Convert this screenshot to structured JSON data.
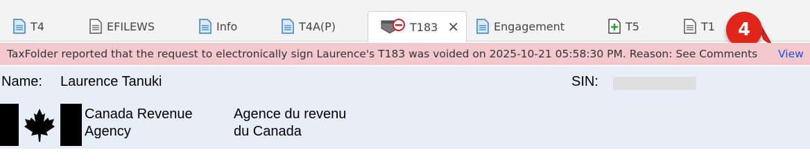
{
  "tabs": [
    {
      "label": "T4",
      "icon": "document-icon"
    },
    {
      "label": "EFILEWS",
      "icon": "document-lines-icon"
    },
    {
      "label": "Info",
      "icon": "document-icon"
    },
    {
      "label": "T4A(P)",
      "icon": "document-icon"
    },
    {
      "label": "T183",
      "icon": "voided-form-icon",
      "active": true,
      "close": "✕"
    },
    {
      "label": "Engagement",
      "icon": "document-icon"
    },
    {
      "label": "T5",
      "icon": "add-document-icon"
    },
    {
      "label": "T1",
      "icon": "document-lines-icon"
    }
  ],
  "badge": {
    "number": "4",
    "color": "#e0261b"
  },
  "notice": {
    "message": "TaxFolder reported that the request to electronically sign Laurence's T183 was voided on 2025-10-21 05:58:30 PM. Reason: See Comments",
    "link": "View",
    "background": "#f3c9ce"
  },
  "form": {
    "name_label": "Name:",
    "name_value": "Laurence Tanuki",
    "sin_label": "SIN:",
    "agency_en_line1": "Canada Revenue",
    "agency_en_line2": "Agency",
    "agency_fr_line1": "Agence du revenu",
    "agency_fr_line2": "du Canada"
  }
}
